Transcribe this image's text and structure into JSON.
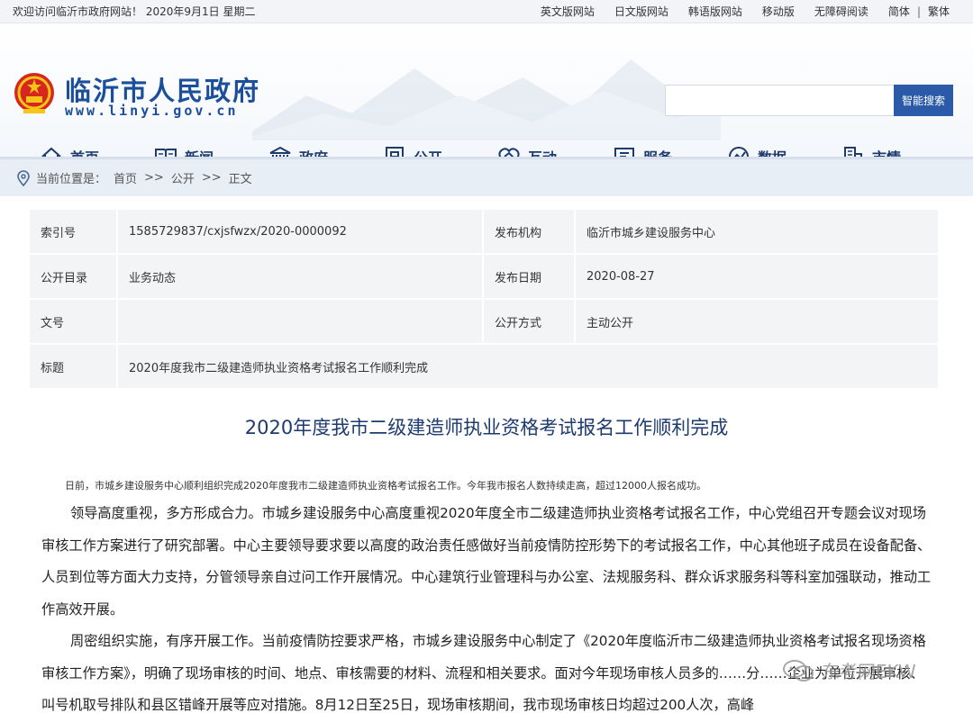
{
  "topbar": {
    "welcome": "欢迎访问临沂市政府网站！ 2020年9月1日  星期二",
    "links": [
      "英文版网站",
      "日文版网站",
      "韩语版网站",
      "移动版",
      "无障碍阅读",
      "简体",
      "繁体"
    ]
  },
  "header": {
    "site_name": "临沂市人民政府",
    "domain": "www.linyi.gov.cn",
    "search_placeholder": "",
    "search_button": "智能搜索"
  },
  "nav": [
    "首页",
    "新闻",
    "政府",
    "公开",
    "互动",
    "服务",
    "数据",
    "市情"
  ],
  "breadcrumb": {
    "label": "当前位置是：",
    "items": [
      "首页",
      ">>",
      "公开",
      ">>",
      "正文"
    ]
  },
  "info": {
    "index_label": "索引号",
    "index_value": "1585729837/cxjsfwzx/2020-0000092",
    "org_label": "发布机构",
    "org_value": "临沂市城乡建设服务中心",
    "catalog_label": "公开目录",
    "catalog_value": "业务动态",
    "date_label": "发布日期",
    "date_value": "2020-08-27",
    "docno_label": "文号",
    "docno_value": "",
    "mode_label": "公开方式",
    "mode_value": "主动公开",
    "title_label": "标题",
    "title_value": "2020年度我市二级建造师执业资格考试报名工作顺利完成"
  },
  "article": {
    "title": "2020年度我市二级建造师执业资格考试报名工作顺利完成",
    "lead": "日前，市城乡建设服务中心顺利组织完成2020年度我市二级建造师执业资格考试报名工作。今年我市报名人数持续走高，超过12000人报名成功。",
    "p1": "领导高度重视，多方形成合力。市城乡建设服务中心高度重视2020年度全市二级建造师执业资格考试报名工作，中心党组召开专题会议对现场审核工作方案进行了研究部署。中心主要领导要求要以高度的政治责任感做好当前疫情防控形势下的考试报名工作，中心其他班子成员在设备配备、人员到位等方面大力支持，分管领导亲自过问工作开展情况。中心建筑行业管理科与办公室、法规服务科、群众诉求服务科等科室加强联动，推动工作高效开展。",
    "p2": "周密组织实施，有序开展工作。当前疫情防控要求严格，市城乡建设服务中心制定了《2020年度临沂市二级建造师执业资格考试报名现场资格审核工作方案》，明确了现场审核的时间、地点、审核需要的材料、流程和相关要求。面对今年现场审核人员多的……分……企业为单位开展审核、叫号机取号排队和县区错峰开展等应对措施。8月12日至25日，现场审核期间，我市现场审核日均超过200人次，高峰"
  },
  "watermark": "东考网EKW"
}
